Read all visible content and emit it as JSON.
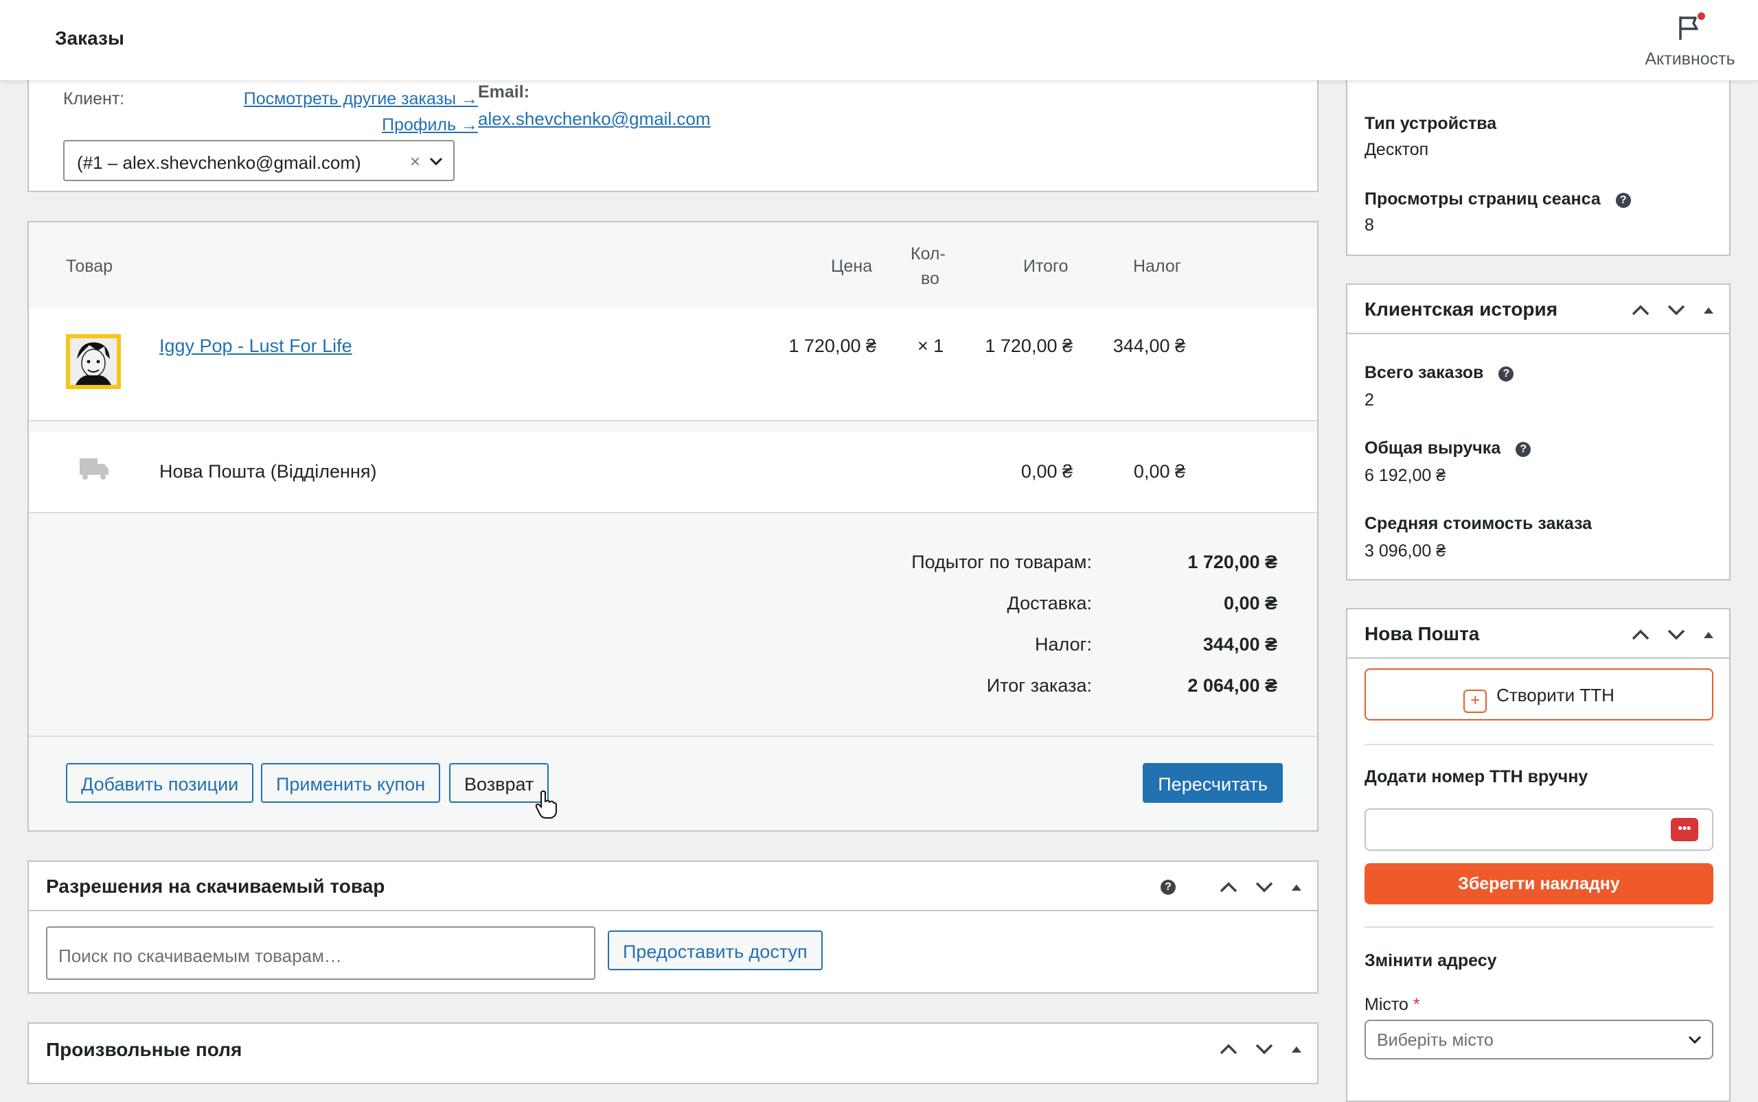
{
  "topbar": {
    "title": "Заказы",
    "activity_label": "Активность"
  },
  "customer": {
    "label": "Клиент:",
    "view_orders_link": "Посмотреть другие заказы →",
    "profile_link": "Профиль →",
    "selected": "(#1 – alex.shevchenko@gmail.com)",
    "clear": "×",
    "email_label": "Email:",
    "email": "alex.shevchenko@gmail.com"
  },
  "items": {
    "columns": {
      "product": "Товар",
      "price": "Цена",
      "qty_line1": "Кол-",
      "qty_line2": "во",
      "total": "Итого",
      "tax": "Налог"
    },
    "product_row": {
      "name": "Iggy Pop - Lust For Life",
      "price": "1 720,00 ₴",
      "qty": "× 1",
      "total": "1 720,00 ₴",
      "tax": "344,00 ₴"
    },
    "shipping_row": {
      "name": "Нова Пошта (Відділення)",
      "total": "0,00 ₴",
      "tax": "0,00 ₴"
    },
    "totals": [
      {
        "label": "Подытог по товарам:",
        "value": "1 720,00 ₴"
      },
      {
        "label": "Доставка:",
        "value": "0,00 ₴"
      },
      {
        "label": "Налог:",
        "value": "344,00 ₴"
      },
      {
        "label": "Итог заказа:",
        "value": "2 064,00 ₴"
      }
    ],
    "buttons": {
      "add_items": "Добавить позиции",
      "apply_coupon": "Применить купон",
      "refund": "Возврат",
      "recalculate": "Пересчитать"
    }
  },
  "downloads": {
    "title": "Разрешения на скачиваемый товар",
    "search_placeholder": "Поиск по скачиваемым товарам…",
    "grant_button": "Предоставить доступ"
  },
  "custom_fields": {
    "title": "Произвольные поля"
  },
  "session": {
    "device_label": "Тип устройства",
    "device_value": "Десктоп",
    "pageviews_label": "Просмотры страниц сеанса",
    "pageviews_value": "8"
  },
  "customer_history": {
    "title": "Клиентская история",
    "total_orders_label": "Всего заказов",
    "total_orders_value": "2",
    "revenue_label": "Общая выручка",
    "revenue_value": "6 192,00 ₴",
    "avg_label": "Средняя стоимость заказа",
    "avg_value": "3 096,00 ₴"
  },
  "nova_poshta": {
    "title": "Нова Пошта",
    "create_ttn": "Створити ТТН",
    "manual_label": "Додати номер ТТН вручну",
    "save_button": "Зберегти накладну",
    "change_address": "Змінити адресу",
    "city_label": "Місто",
    "required_mark": "*",
    "city_placeholder": "Виберіть місто"
  }
}
